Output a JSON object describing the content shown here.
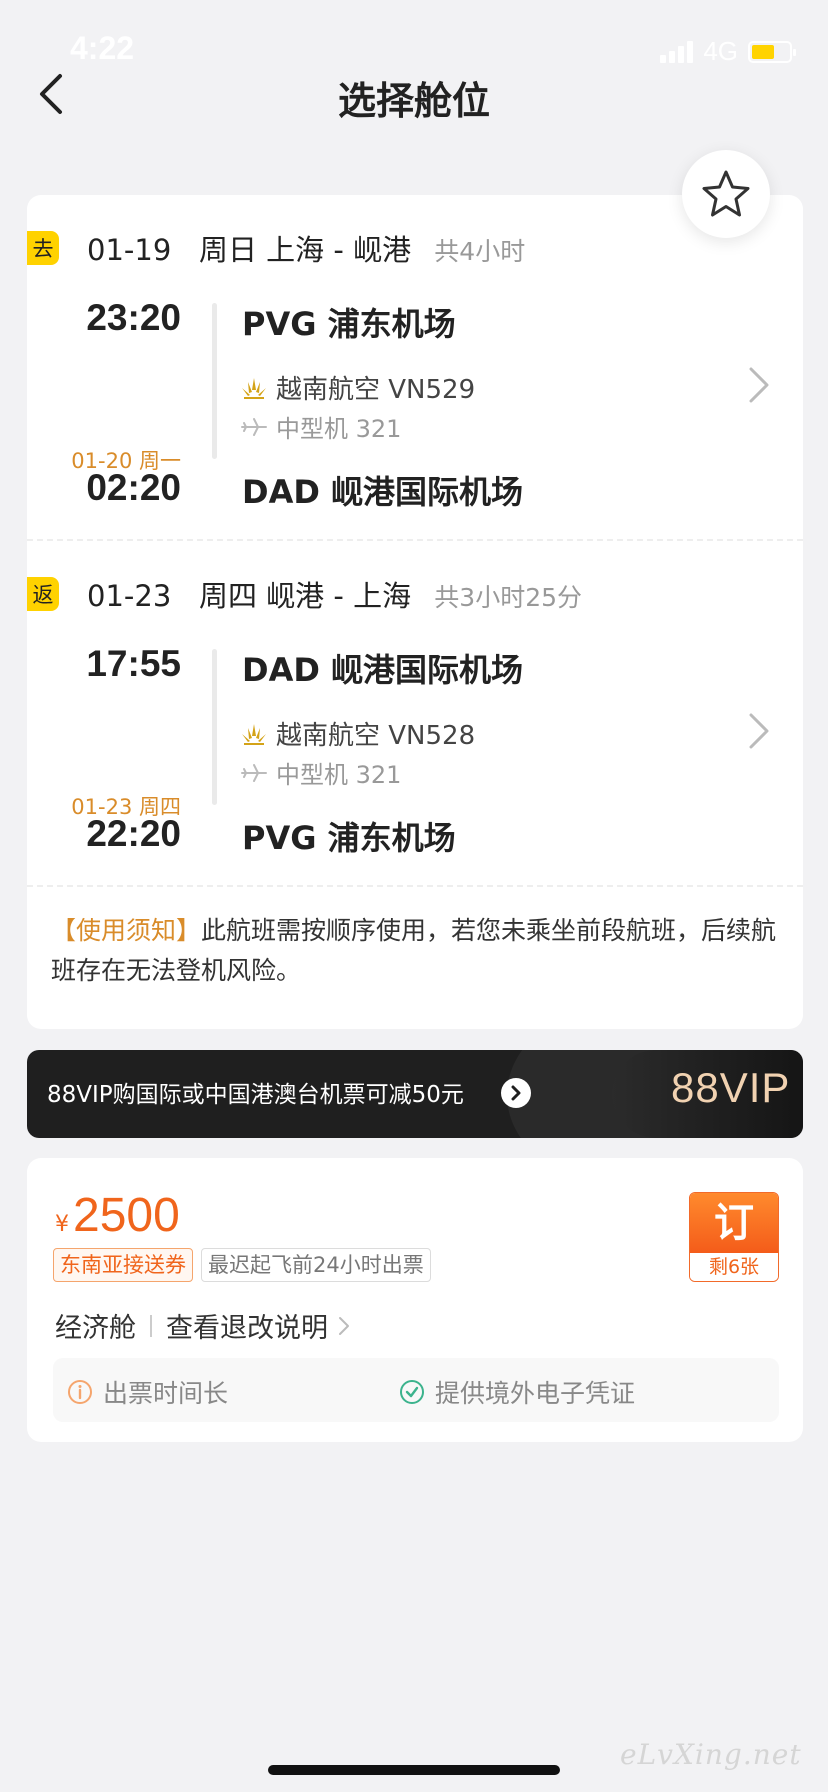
{
  "status": {
    "time": "4:22",
    "network": "4G"
  },
  "header": {
    "title": "选择舱位"
  },
  "outbound": {
    "badge": "去",
    "date": "01-19",
    "weekday": "周日",
    "route": "上海 - 岘港",
    "duration": "共4小时",
    "dep_time": "23:20",
    "dep_airport": "PVG 浦东机场",
    "airline": "越南航空 VN529",
    "aircraft": "中型机 321",
    "arr_date": "01-20 周一",
    "arr_time": "02:20",
    "arr_airport": "DAD 岘港国际机场"
  },
  "return": {
    "badge": "返",
    "date": "01-23",
    "weekday": "周四",
    "route": "岘港 - 上海",
    "duration": "共3小时25分",
    "dep_time": "17:55",
    "dep_airport": "DAD 岘港国际机场",
    "airline": "越南航空 VN528",
    "aircraft": "中型机 321",
    "arr_date": "01-23 周四",
    "arr_time": "22:20",
    "arr_airport": "PVG 浦东机场"
  },
  "notice": {
    "label": "【使用须知】",
    "text": "此航班需按顺序使用，若您未乘坐前段航班，后续航班存在无法登机风险。"
  },
  "vip_banner": {
    "text": "88VIP购国际或中国港澳台机票可减50元",
    "logo": "88VIP"
  },
  "fare": {
    "currency": "¥",
    "price": "2500",
    "tags": [
      "东南亚接送券",
      "最迟起飞前24小时出票"
    ],
    "cabin": "经济舱",
    "rules_link": "查看退改说明",
    "book_label": "订",
    "remaining": "剩6张",
    "info_left": "出票时间长",
    "info_right": "提供境外电子凭证"
  },
  "watermark": "eLvXing.net",
  "colors": {
    "accent": "#f0651c",
    "badge": "#ffd200",
    "date_highlight": "#d98c2a"
  }
}
